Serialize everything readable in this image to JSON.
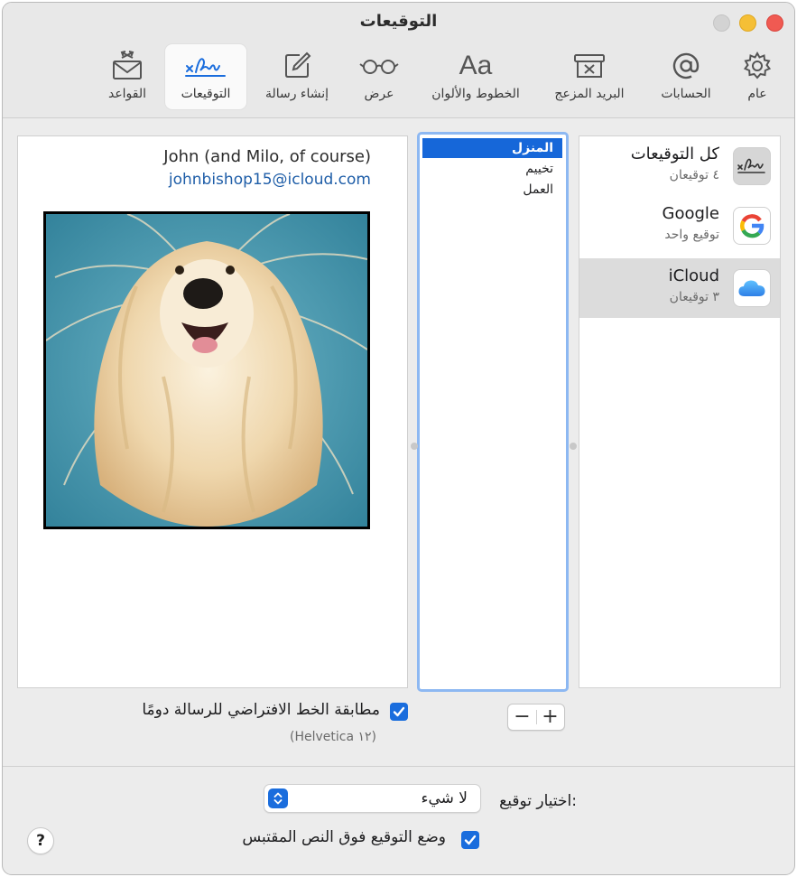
{
  "window": {
    "title": "التوقيعات"
  },
  "toolbar": {
    "items": [
      {
        "label": "عام",
        "icon": "gear-icon"
      },
      {
        "label": "الحسابات",
        "icon": "at-sign-icon"
      },
      {
        "label": "البريد المزعج",
        "icon": "junk-mail-icon"
      },
      {
        "label": "الخطوط والألوان",
        "icon": "fonts-icon",
        "glyph": "Aa"
      },
      {
        "label": "عرض",
        "icon": "glasses-icon"
      },
      {
        "label": "إنشاء رسالة",
        "icon": "compose-icon"
      },
      {
        "label": "التوقيعات",
        "icon": "signature-icon",
        "active": true
      },
      {
        "label": "القواعد",
        "icon": "rules-envelope-icon"
      }
    ]
  },
  "accounts": [
    {
      "name": "كل التوقيعات",
      "count": "٤ توقيعان",
      "icon": "signature-icon"
    },
    {
      "name": "Google",
      "count": "توقيع واحد",
      "icon": "google-icon"
    },
    {
      "name": "iCloud",
      "count": "٣ توقيعان",
      "icon": "icloud-icon",
      "selected": true
    }
  ],
  "signatures": [
    {
      "label": "المنزل",
      "selected": true
    },
    {
      "label": "تخييم"
    },
    {
      "label": "العمل"
    }
  ],
  "preview": {
    "name": "John (and Milo, of course)",
    "email": "johnbishop15@icloud.com",
    "image": "dog-photo"
  },
  "list_controls": {
    "plus": "+",
    "minus": "−"
  },
  "match_font": {
    "label": "مطابقة الخط الافتراضي للرسالة دومًا",
    "font": "(Helvetica ١٢)",
    "checked": true
  },
  "choose_signature": {
    "label": "اختيار توقيع:",
    "value": "لا شيء"
  },
  "place_signature": {
    "label": "وضع التوقيع فوق النص المقتبس",
    "checked": true
  },
  "help": {
    "label": "?"
  },
  "colors": {
    "accent": "#1a6ddd",
    "link": "#1f5ea8",
    "selection": "#1667d9"
  }
}
